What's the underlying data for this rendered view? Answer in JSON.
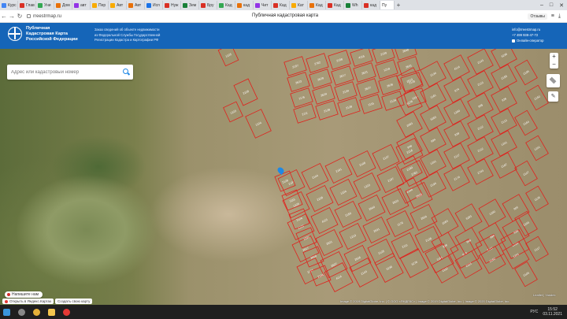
{
  "browser": {
    "tabs": [
      {
        "label": "Курс",
        "color": "#4285f4"
      },
      {
        "label": "Глав",
        "color": "#d93025"
      },
      {
        "label": "Уни",
        "color": "#34a853"
      },
      {
        "label": "Дом",
        "color": "#e8710a"
      },
      {
        "label": "авт",
        "color": "#9334e6"
      },
      {
        "label": "Пер",
        "color": "#f9ab00"
      },
      {
        "label": "Авт",
        "color": "#f9ab00"
      },
      {
        "label": "Авт",
        "color": "#e8710a"
      },
      {
        "label": "Исп",
        "color": "#1a73e8"
      },
      {
        "label": "Нуж",
        "color": "#d93025"
      },
      {
        "label": "Зем",
        "color": "#188038"
      },
      {
        "label": "Бру",
        "color": "#d93025"
      },
      {
        "label": "Кад",
        "color": "#34a853"
      },
      {
        "label": "кад",
        "color": "#e8710a"
      },
      {
        "label": "Чит",
        "color": "#9334e6"
      },
      {
        "label": "Кад",
        "color": "#d93025"
      },
      {
        "label": "Кат",
        "color": "#f9ab00"
      },
      {
        "label": "Кад",
        "color": "#e8710a"
      },
      {
        "label": "Кад",
        "color": "#d93025"
      },
      {
        "label": "Wh",
        "color": "#188038"
      },
      {
        "label": "кад",
        "color": "#d93025"
      }
    ],
    "active_tab": "Пу",
    "new_tab": "+",
    "window_controls": [
      "–",
      "□",
      "✕"
    ],
    "url": "rreestrmap.ru",
    "page_title": "Публичная кадастровая карта",
    "feedback_label": "Отзывы",
    "nav": {
      "back": "←",
      "forward": "→",
      "reload": "↻"
    }
  },
  "site_header": {
    "brand_lines": [
      "Публичная",
      "Кадастровая Карта",
      "Российской Федерации"
    ],
    "description_lines": [
      "Заказ сведений об объекте недвижимости",
      "из Федеральной Службы Государственной",
      "Регистрации Кадастра и Картографии РФ"
    ],
    "email": "info@rreestrmap.ru",
    "phone": "+7 499 938-47-72",
    "operator_label": "Онлайн-оператор"
  },
  "map": {
    "search_placeholder": "Адрес или кадастровый номер",
    "zoom_in": "+",
    "zoom_out": "−",
    "ruler_icon": "✎",
    "attribution": "Image © 2019 DigitalGlobe, Inc. | © ООО «ЯНДЕКС» | Image © 2019 DigitalGlobe, Inc. | Image © 2020 DigitalGlobe, Inc.",
    "leaflet_label": "Leaflet | Yandex",
    "notify_label": "Напишите нам",
    "yandex_label": "Открыть в Яндекс.Картах",
    "create_label": "Создать свою карту",
    "parcel_labels": [
      "1225",
      "2228",
      "1224",
      "1223",
      "2157",
      "2762",
      "2158",
      "4115",
      "2159",
      "2640",
      "2623",
      "2629",
      "2617",
      "2621",
      "1219",
      "2631",
      "1176",
      "2624",
      "2134",
      "2627",
      "2626",
      "2125",
      "2111",
      "2128",
      "2128",
      "1115",
      "2124",
      "1237",
      "2619",
      "2134",
      "4114",
      "2143",
      "3236",
      "3278",
      "1161",
      "874",
      "2113",
      "2155",
      "2063",
      "3263",
      "1200",
      "905",
      "926",
      "948",
      "894",
      "939",
      "2112",
      "2113",
      "2150",
      "1241",
      "2117",
      "2112",
      "1241",
      "2184",
      "2194",
      "2174",
      "2743",
      "2187",
      "2195",
      "2150",
      "2164",
      "1241",
      "2147",
      "1128",
      "2249",
      "2117",
      "2109",
      "2107",
      "2144",
      "2161",
      "2148",
      "2137",
      "2216"
    ]
  },
  "taskbar": {
    "lang": "РУС",
    "time": "15:52",
    "date": "03.11.2021",
    "icons": [
      "windows-icon",
      "search-icon",
      "chrome-icon",
      "explorer-icon",
      "yandex-icon"
    ]
  }
}
